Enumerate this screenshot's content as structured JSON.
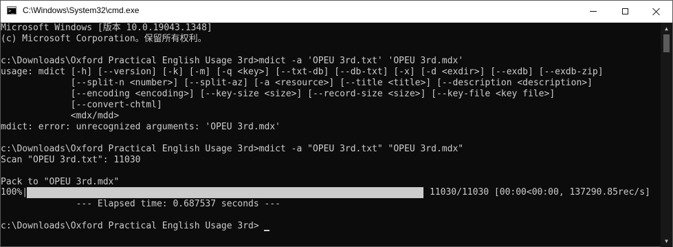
{
  "window": {
    "title": "C:\\Windows\\System32\\cmd.exe",
    "icon": "cmd-app-icon",
    "controls": {
      "minimize": "minimize-icon",
      "maximize": "maximize-icon",
      "close": "close-icon"
    }
  },
  "console": {
    "lines": [
      "Microsoft Windows [版本 10.0.19043.1348]",
      "(c) Microsoft Corporation。保留所有权利。",
      "",
      "c:\\Downloads\\Oxford Practical English Usage 3rd>mdict -a 'OPEU 3rd.txt' 'OPEU 3rd.mdx'",
      "usage: mdict [-h] [--version] [-k] [-m] [-q <key>] [--txt-db] [--db-txt] [-x] [-d <exdir>] [--exdb] [--exdb-zip]",
      "             [--split-n <number>] [--split-az] [-a <resource>] [--title <title>] [--description <description>]",
      "             [--encoding <encoding>] [--key-size <size>] [--record-size <size>] [--key-file <key file>]",
      "             [--convert-chtml]",
      "             <mdx/mdd>",
      "mdict: error: unrecognized arguments: 'OPEU 3rd.mdx'",
      "",
      "c:\\Downloads\\Oxford Practical English Usage 3rd>mdict -a \"OPEU 3rd.txt\" \"OPEU 3rd.mdx\"",
      "Scan \"OPEU 3rd.txt\": 11030",
      "",
      "Pack to \"OPEU 3rd.mdx\""
    ],
    "progress": {
      "percent_text": "100%|",
      "fraction": 1.0,
      "stats_text": "11030/11030 [00:00<00:00, 137290.85rec/s]"
    },
    "elapsed": "              --- Elapsed time: 0.687537 seconds ---",
    "final_prompt": "c:\\Downloads\\Oxford Practical English Usage 3rd>"
  },
  "colors": {
    "background": "#0c0c0c",
    "text": "#cccccc",
    "progress_fill": "#cccccc"
  }
}
